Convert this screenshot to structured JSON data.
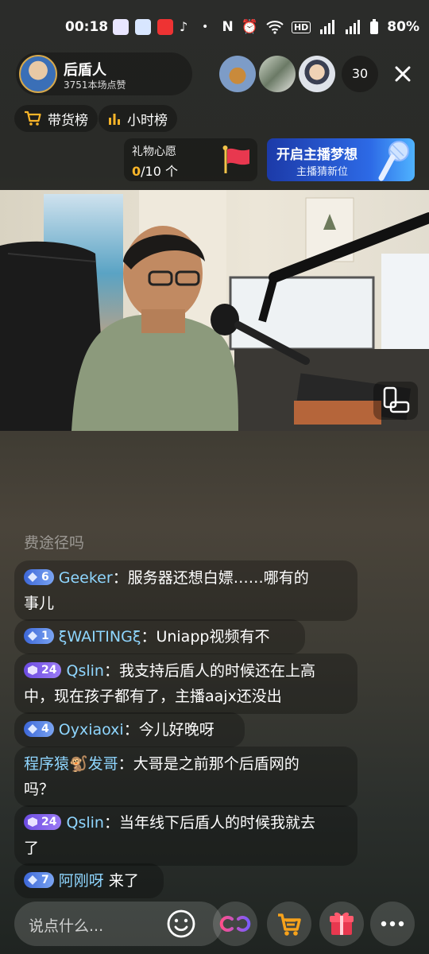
{
  "status_bar": {
    "time": "00:18",
    "battery": "80%"
  },
  "host": {
    "name": "后盾人",
    "likes": "3751本场点赞"
  },
  "viewers": {
    "count": "30"
  },
  "rank_buttons": [
    {
      "label": "带货榜"
    },
    {
      "label": "小时榜"
    }
  ],
  "gift_wish": {
    "title": "礼物心愿",
    "current": "0",
    "total": "/10 个"
  },
  "dream_banner": {
    "title": "开启主播梦想",
    "subtitle": "主播猜新位"
  },
  "comments": {
    "faded": "费途径吗",
    "items": [
      {
        "level": "6",
        "badge": "blue",
        "user": "Geeker",
        "sep": "：",
        "text": "服务器还想白嫖……哪有的",
        "text2": "事儿"
      },
      {
        "level": "1",
        "badge": "blue",
        "user": "ξWAITINGξ",
        "sep": "：",
        "text": "Uniapp视频有不"
      },
      {
        "level": "24",
        "badge": "purple",
        "user": "Qslin",
        "sep": "：",
        "text": "我支持后盾人的时候还在上高",
        "text2": "中，现在孩子都有了，主播aajx还没出"
      },
      {
        "level": "4",
        "badge": "blue",
        "user": "Oyxiaoxi",
        "sep": "：",
        "text": "今儿好晚呀"
      },
      {
        "user": "程序猿🐒发哥",
        "sep": "：",
        "text": "大哥是之前那个后盾网的",
        "text2": "吗？"
      },
      {
        "level": "24",
        "badge": "purple",
        "user": "Qslin",
        "sep": "：",
        "text": "当年线下后盾人的时候我就去",
        "text2": "了"
      },
      {
        "level": "7",
        "badge": "blue",
        "user": "阿刚呀",
        "sep": " ",
        "text": "来了"
      }
    ]
  },
  "input": {
    "placeholder": "说点什么..."
  },
  "colors": {
    "accent_gold": "#f9b529",
    "username": "#8fd6ff",
    "gift_red": "#e8384f",
    "cart_orange": "#f7a21b"
  }
}
